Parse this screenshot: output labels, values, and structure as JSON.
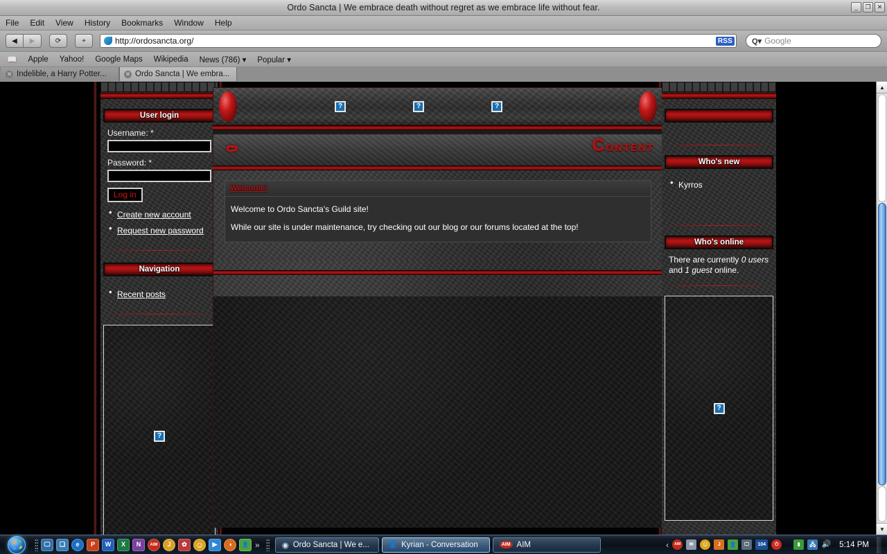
{
  "window": {
    "title": "Ordo Sancta | We embrace death without regret as we embrace life without fear.",
    "minimize": "_",
    "maximize": "❐",
    "close": "✕"
  },
  "menubar": {
    "items": [
      "File",
      "Edit",
      "View",
      "History",
      "Bookmarks",
      "Window",
      "Help"
    ]
  },
  "navbar": {
    "back": "◀",
    "forward": "▶",
    "reload": "⟳",
    "add": "+",
    "url": "http://ordosancta.org/",
    "rss": "RSS",
    "search_icon": "Q▾",
    "search_placeholder": "Google"
  },
  "bookmarks": {
    "book_icon": "📖",
    "items": [
      "Apple",
      "Yahoo!",
      "Google Maps",
      "Wikipedia",
      "News (786) ▾",
      "Popular ▾"
    ]
  },
  "tabs": [
    {
      "label": "Indelible, a Harry Potter...",
      "close": "✕",
      "active": false
    },
    {
      "label": "Ordo Sancta | We embra...",
      "close": "✕",
      "active": true
    }
  ],
  "page": {
    "banner": {
      "placeholders": [
        "?",
        "?",
        "?"
      ]
    },
    "content_header": {
      "glyph": "⚰",
      "word_first": "C",
      "word_rest": "ONTENT"
    },
    "node": {
      "title": "Welcome!",
      "paragraphs": [
        "Welcome to Ordo Sancta's Guild site!",
        "While our site is under maintenance, try checking out our blog or our forums located at the top!"
      ]
    },
    "left_sidebar": {
      "login_block": {
        "title": "User login",
        "username_label": "Username: *",
        "username_value": "",
        "password_label": "Password: *",
        "password_value": "",
        "submit_label": "Log in",
        "links": [
          "Create new account",
          "Request new password"
        ]
      },
      "nav_block": {
        "title": "Navigation",
        "links": [
          "Recent posts"
        ]
      },
      "image_placeholder": "?"
    },
    "right_sidebar": {
      "top_block": {
        "title": ""
      },
      "whos_new": {
        "title": "Who's new",
        "users": [
          "Kyrros"
        ]
      },
      "whos_online": {
        "title": "Who's online",
        "text_parts": [
          "There are currently ",
          "0 users",
          " and ",
          "1 guest",
          " online."
        ]
      },
      "image_placeholder": "?"
    }
  },
  "scrollbar": {
    "up_arrow": "▲",
    "down_arrow": "▼"
  },
  "taskbar": {
    "start_tooltip": "Start",
    "quick_launch": [
      {
        "name": "show-desktop",
        "glyph": "🖵",
        "color": "#2f6fa8"
      },
      {
        "name": "switch-windows",
        "glyph": "❏",
        "color": "#3b7cb5"
      },
      {
        "name": "internet-explorer",
        "glyph": "e",
        "color": "#1b6fc4"
      },
      {
        "name": "powerpoint",
        "glyph": "P",
        "color": "#c8411f"
      },
      {
        "name": "word",
        "glyph": "W",
        "color": "#1f5fb8"
      },
      {
        "name": "excel",
        "glyph": "X",
        "color": "#1d7a44"
      },
      {
        "name": "onenote",
        "glyph": "N",
        "color": "#7b3fa0"
      },
      {
        "name": "aim",
        "glyph": "AIM",
        "color": "#c42b1c"
      },
      {
        "name": "java",
        "glyph": "J",
        "color": "#d9a022"
      },
      {
        "name": "flower",
        "glyph": "✿",
        "color": "#b83a3a"
      },
      {
        "name": "smiley",
        "glyph": "☺",
        "color": "#d9a41f"
      },
      {
        "name": "media-player",
        "glyph": "▶",
        "color": "#2f86d6"
      },
      {
        "name": "firefox",
        "glyph": "◑",
        "color": "#d96a1f"
      },
      {
        "name": "contacts",
        "glyph": "👤",
        "color": "#4aa33c"
      }
    ],
    "overflow": "»",
    "tasks": [
      {
        "label": "Ordo Sancta | We e...",
        "icon": "◉",
        "active": false
      },
      {
        "label": "Kyrian - Conversation",
        "icon": "👤",
        "active": true
      },
      {
        "label": "AIM",
        "icon": "AIM",
        "active": false
      }
    ],
    "tray": {
      "expand": "‹",
      "icons": [
        {
          "name": "aim-tray",
          "glyph": "AIM",
          "color": "#c42b1c"
        },
        {
          "name": "mail-tray",
          "glyph": "✉",
          "color": "#8d98a8"
        },
        {
          "name": "smiley-tray",
          "glyph": "☺",
          "color": "#d9a41f"
        },
        {
          "name": "java-tray",
          "glyph": "J",
          "color": "#d9701f"
        },
        {
          "name": "contacts-tray",
          "glyph": "👤",
          "color": "#4aa33c"
        },
        {
          "name": "display-tray",
          "glyph": "🖵",
          "color": "#5a6b7c"
        },
        {
          "name": "counter-tray",
          "glyph": "104",
          "color": "#1c4f96"
        },
        {
          "name": "shutdown-tray",
          "glyph": "⏻",
          "color": "#cc2a1f"
        },
        {
          "name": "battery-tray",
          "glyph": "▮",
          "color": "#3a9a3a"
        },
        {
          "name": "network-tray",
          "glyph": "🖧",
          "color": "#3a7ab5"
        },
        {
          "name": "volume-tray",
          "glyph": "🔊",
          "color": "#8fa6bd"
        }
      ],
      "clock": "5:14 PM"
    }
  }
}
